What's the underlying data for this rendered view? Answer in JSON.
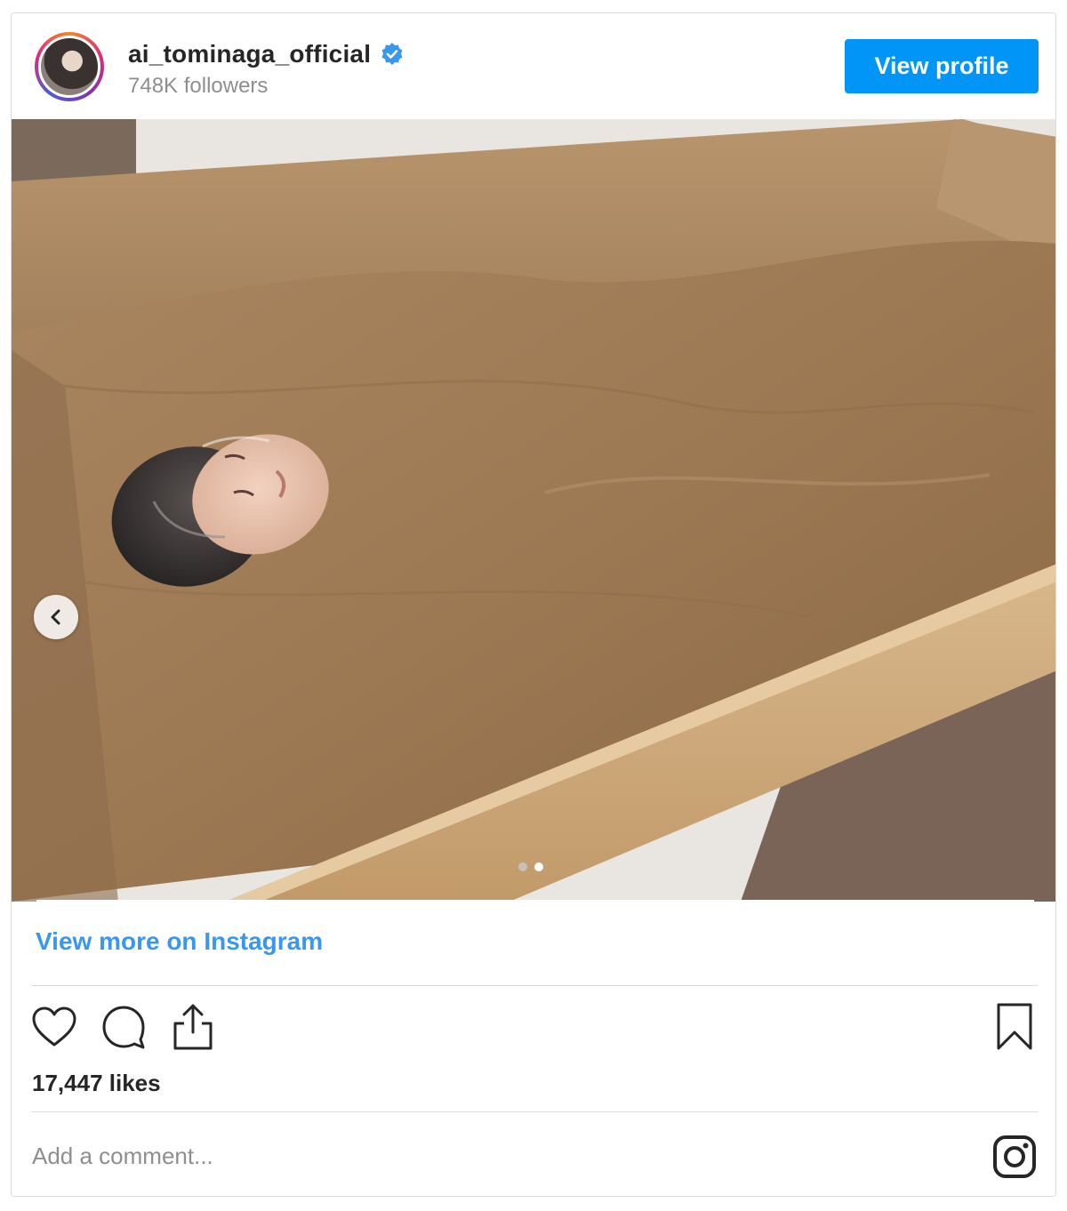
{
  "header": {
    "username": "ai_tominaga_official",
    "followers": "748K followers",
    "view_profile_label": "View profile",
    "verified_icon": "verified-badge-icon",
    "verified_color": "#3897f0"
  },
  "photo": {
    "description_icon": "sand-bath-photo",
    "carousel": {
      "total": 2,
      "current": 2
    },
    "prev_icon": "chevron-left-icon"
  },
  "footer": {
    "view_more_label": "View more on Instagram",
    "likes": "17,447 likes",
    "comment_placeholder": "Add a comment...",
    "icons": [
      "heart-icon",
      "comment-icon",
      "share-icon",
      "bookmark-icon",
      "instagram-logo-icon"
    ]
  },
  "colors": {
    "primary_button": "#0095f6",
    "link": "#3897f0",
    "muted_text": "#8e8e8e",
    "border": "#dbdbdb"
  }
}
